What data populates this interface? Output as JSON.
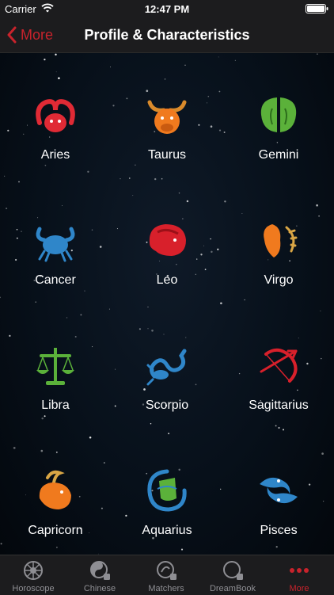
{
  "status_bar": {
    "carrier": "Carrier",
    "time": "12:47 PM"
  },
  "nav": {
    "back_label": "More",
    "title": "Profile & Characteristics"
  },
  "colors": {
    "accent": "#c8232c",
    "background": "#07101a",
    "tab_inactive": "#8e8e93"
  },
  "signs": [
    {
      "label": "Aries",
      "icon": "aries-icon",
      "color": "#e02a35"
    },
    {
      "label": "Taurus",
      "icon": "taurus-icon",
      "color": "#f07a1e"
    },
    {
      "label": "Gemini",
      "icon": "gemini-icon",
      "color": "#5bb13a"
    },
    {
      "label": "Cancer",
      "icon": "cancer-icon",
      "color": "#2f86c9"
    },
    {
      "label": "Leo",
      "icon": "leo-icon",
      "color": "#d8202b"
    },
    {
      "label": "Virgo",
      "icon": "virgo-icon",
      "color": "#f07a1e"
    },
    {
      "label": "Libra",
      "icon": "libra-icon",
      "color": "#5bb13a"
    },
    {
      "label": "Scorpio",
      "icon": "scorpio-icon",
      "color": "#2f86c9"
    },
    {
      "label": "Sagittarius",
      "icon": "sagittarius-icon",
      "color": "#d8202b"
    },
    {
      "label": "Capricorn",
      "icon": "capricorn-icon",
      "color": "#f07a1e"
    },
    {
      "label": "Aquarius",
      "icon": "aquarius-icon",
      "color": "#5bb13a"
    },
    {
      "label": "Pisces",
      "icon": "pisces-icon",
      "color": "#2f86c9"
    }
  ],
  "tabs": [
    {
      "label": "Horoscope",
      "icon": "zodiac-wheel-icon",
      "active": false
    },
    {
      "label": "Chinese",
      "icon": "yin-yang-icon",
      "active": false
    },
    {
      "label": "Matchers",
      "icon": "matchers-icon",
      "active": false
    },
    {
      "label": "DreamBook",
      "icon": "moon-icon",
      "active": false
    },
    {
      "label": "More",
      "icon": "more-dots-icon",
      "active": true
    }
  ]
}
